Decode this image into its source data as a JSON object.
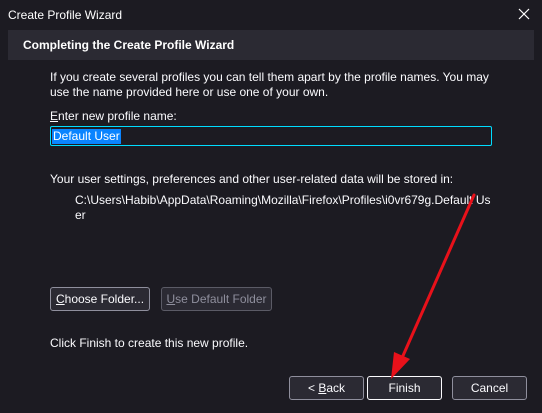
{
  "window": {
    "title": "Create Profile Wizard",
    "close_glyph": "✕"
  },
  "header": {
    "title": "Completing the Create Profile Wizard"
  },
  "intro": "If you create several profiles you can tell them apart by the profile names. You may use the name provided here or use one of your own.",
  "profile_name": {
    "label_first": "E",
    "label_rest": "nter new profile name:",
    "value": "Default User"
  },
  "settings": {
    "text": "Your user settings, preferences and other user-related data will be stored in:",
    "path": "C:\\Users\\Habib\\AppData\\Roaming\\Mozilla\\Firefox\\Profiles\\i0vr679g.Default User"
  },
  "buttons": {
    "choose_first": "C",
    "choose_rest": "hoose Folder...",
    "default_first": "U",
    "default_rest": "se Default Folder",
    "back_prefix": "< ",
    "back_first": "B",
    "back_rest": "ack",
    "finish": "Finish",
    "cancel": "Cancel"
  },
  "finish_text": "Click Finish to create this new profile.",
  "colors": {
    "background": "#1c1b22",
    "header": "#2b2a33",
    "focus": "#00ddff",
    "selection": "#0a84ff",
    "annotation_arrow": "#e8111a"
  },
  "icons": {
    "close": "close-icon",
    "annotation": "red-arrow-annotation"
  }
}
